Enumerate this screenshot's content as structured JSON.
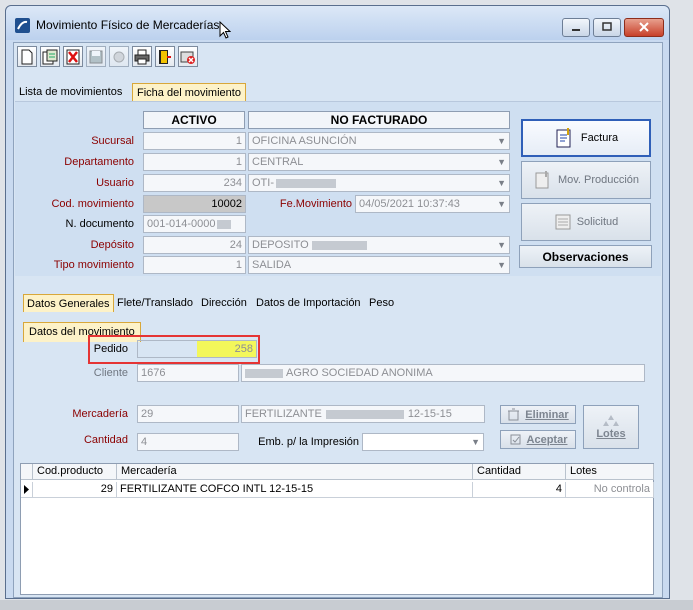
{
  "window": {
    "title": "Movimiento Físico de Mercaderías"
  },
  "toolbar": {
    "icons": [
      "new-document-icon",
      "save-copy-icon",
      "delete-icon",
      "save-icon",
      "edit-icon",
      "print-icon",
      "export-icon",
      "cancel-icon"
    ]
  },
  "tabs": [
    {
      "label": "Lista de movimientos",
      "active": false
    },
    {
      "label": "Ficha del movimiento",
      "active": true
    }
  ],
  "status": {
    "estado": "ACTIVO",
    "facturacion": "NO FACTURADO"
  },
  "form": {
    "sucursal": {
      "label": "Sucursal",
      "code": "1",
      "name": "OFICINA ASUNCIÓN"
    },
    "departamento": {
      "label": "Departamento",
      "code": "1",
      "name": "CENTRAL"
    },
    "usuario": {
      "label": "Usuario",
      "code": "234",
      "name": "OTI-"
    },
    "cod_movimiento": {
      "label": "Cod. movimiento",
      "value": "10002"
    },
    "fe_movimiento": {
      "label": "Fe.Movimiento",
      "value": "04/05/2021 10:37:43"
    },
    "n_documento": {
      "label": "N. documento",
      "value": "001-014-0000"
    },
    "deposito": {
      "label": "Depósito",
      "code": "24",
      "name": "DEPOSITO "
    },
    "tipo_movimiento": {
      "label": "Tipo movimiento",
      "code": "1",
      "name": "SALIDA"
    }
  },
  "side_buttons": {
    "factura": "Factura",
    "mov_produccion": "Mov. Producción",
    "solicitud": "Solicitud",
    "observaciones": "Observaciones"
  },
  "detail_tabs": [
    {
      "label": "Datos Generales",
      "active": true
    },
    {
      "label": "Flete/Translado",
      "active": false
    },
    {
      "label": "Dirección",
      "active": false
    },
    {
      "label": "Datos de Importación",
      "active": false
    },
    {
      "label": "Peso",
      "active": false
    }
  ],
  "subtab": {
    "label": "Datos del movimiento"
  },
  "detail": {
    "pedido": {
      "label": "Pedido",
      "value": "258"
    },
    "cliente": {
      "label": "Cliente",
      "code": "1676",
      "name": "AGRO SOCIEDAD ANONIMA"
    },
    "mercaderia": {
      "label": "Mercadería",
      "code": "29",
      "name": "FERTILIZANTE",
      "suffix": "12-15-15"
    },
    "cantidad": {
      "label": "Cantidad",
      "value": "4"
    },
    "emb": {
      "label": "Emb. p/ la Impresión",
      "value": ""
    }
  },
  "action_buttons": {
    "eliminar": "Eliminar",
    "aceptar": "Aceptar",
    "lotes": "Lotes"
  },
  "grid": {
    "columns": [
      "Cod.producto",
      "Mercadería",
      "Cantidad",
      "Lotes"
    ],
    "rows": [
      {
        "cod": "29",
        "mercaderia": "FERTILIZANTE COFCO INTL 12-15-15",
        "cantidad": "4",
        "lotes": "No controla"
      }
    ]
  }
}
